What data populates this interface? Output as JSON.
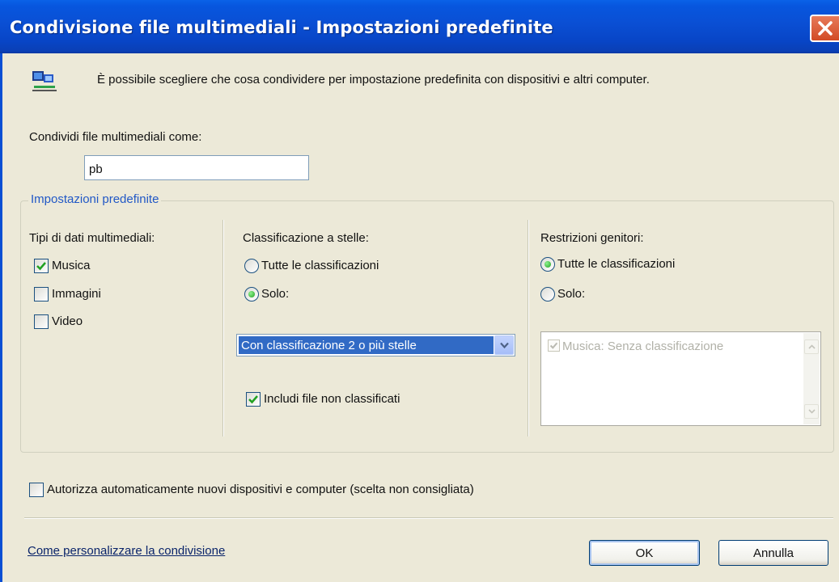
{
  "window": {
    "title": "Condivisione file multimediali - Impostazioni predefinite"
  },
  "intro": {
    "text": "È possibile scegliere che cosa condividere per impostazione predefinita con dispositivi e altri computer."
  },
  "share_as": {
    "label": "Condividi file multimediali come:",
    "value": "pb"
  },
  "defaults_group": {
    "legend": "Impostazioni predefinite",
    "media_types": {
      "heading": "Tipi di dati multimediali:",
      "items": [
        {
          "label": "Musica",
          "checked": true
        },
        {
          "label": "Immagini",
          "checked": false
        },
        {
          "label": "Video",
          "checked": false
        }
      ]
    },
    "star_rating": {
      "heading": "Classificazione a stelle:",
      "option_all": "Tutte le classificazioni",
      "option_only": "Solo:",
      "selected": "only",
      "dropdown_value": "Con classificazione 2 o più stelle",
      "include_unrated": {
        "label": "Includi file non classificati",
        "checked": true
      }
    },
    "parental": {
      "heading": "Restrizioni genitori:",
      "option_all": "Tutte le classificazioni",
      "option_only": "Solo:",
      "selected": "all",
      "list_items": [
        {
          "label": "Musica: Senza classificazione",
          "checked": true,
          "disabled": true
        }
      ]
    }
  },
  "auto_allow": {
    "label": "Autorizza automaticamente nuovi dispositivi e computer (scelta non consigliata)",
    "checked": false
  },
  "footer": {
    "help_link": "Come personalizzare la condivisione",
    "ok_label": "OK",
    "cancel_label": "Annulla"
  },
  "colors": {
    "titlebar": "#0a4fd4",
    "selection": "#316ac5",
    "close_button": "#d24b25",
    "legend_text": "#2158c6"
  }
}
